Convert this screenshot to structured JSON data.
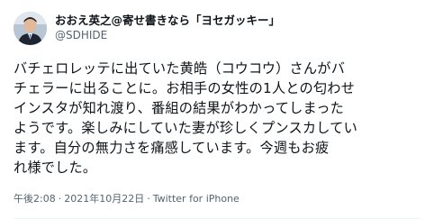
{
  "tweet": {
    "author": {
      "display_name": "おおえ英之@寄せ書きなら「ヨセガッキー」",
      "handle": "@SDHIDE",
      "avatar_icon": "profile-photo"
    },
    "text_lines": [
      "バチェロレッテに出ていた黄皓（コウコウ）さんがバ",
      "チェラーに出ることに。お相手の女性の1人との匂わせ",
      "インスタが知れ渡り、番組の結果がわかってしまった",
      "ようです。楽しみにしていた妻が珍しくプンスカしてい",
      "ます。自分の無力さを痛感しています。今週もお疲",
      "れ様でした。"
    ],
    "time": "午後2:08",
    "separator": "·",
    "date": "2021年10月22日",
    "source": "Twitter for iPhone"
  },
  "colors": {
    "text": "#0f1419",
    "secondary_text": "#536471",
    "background": "#ffffff"
  }
}
